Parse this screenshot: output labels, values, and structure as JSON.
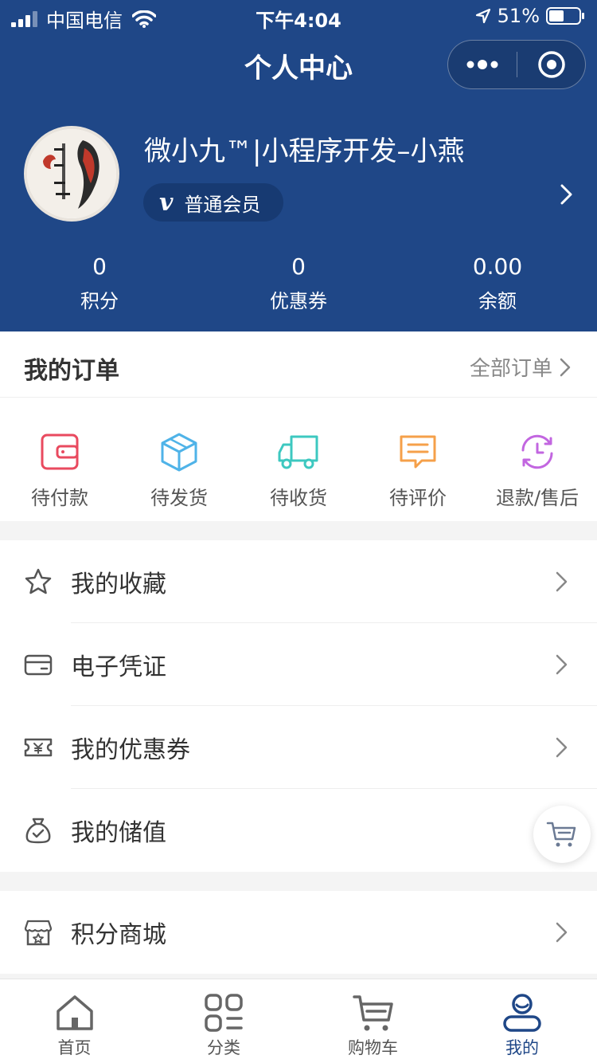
{
  "status_bar": {
    "carrier": "中国电信",
    "time": "下午4:04",
    "battery": "51%"
  },
  "nav": {
    "title": "个人中心"
  },
  "profile": {
    "name": "微小九™|小程序开发–小燕",
    "member_level": "普通会员",
    "member_badge_letter": "v"
  },
  "stats": [
    {
      "value": "0",
      "label": "积分"
    },
    {
      "value": "0",
      "label": "优惠券"
    },
    {
      "value": "0.00",
      "label": "余额"
    }
  ],
  "orders": {
    "title": "我的订单",
    "all_label": "全部订单",
    "items": [
      {
        "label": "待付款",
        "icon": "wallet-icon",
        "color": "#e94a5f"
      },
      {
        "label": "待发货",
        "icon": "box-icon",
        "color": "#4fb3e8"
      },
      {
        "label": "待收货",
        "icon": "truck-icon",
        "color": "#3dc8c0"
      },
      {
        "label": "待评价",
        "icon": "comment-icon",
        "color": "#f5a04a"
      },
      {
        "label": "退款/售后",
        "icon": "refund-icon",
        "color": "#c266e0"
      }
    ]
  },
  "menu": [
    {
      "label": "我的收藏",
      "icon": "star-icon"
    },
    {
      "label": "电子凭证",
      "icon": "card-icon"
    },
    {
      "label": "我的优惠券",
      "icon": "coupon-icon"
    },
    {
      "label": "我的储值",
      "icon": "money-bag-icon"
    }
  ],
  "menu2": [
    {
      "label": "积分商城",
      "icon": "store-icon"
    }
  ],
  "tabbar": [
    {
      "label": "首页",
      "icon": "home-icon"
    },
    {
      "label": "分类",
      "icon": "category-icon"
    },
    {
      "label": "购物车",
      "icon": "cart-icon"
    },
    {
      "label": "我的",
      "icon": "user-icon",
      "active": true
    }
  ],
  "colors": {
    "brand": "#1f4787",
    "background": "#f4f4f4"
  }
}
